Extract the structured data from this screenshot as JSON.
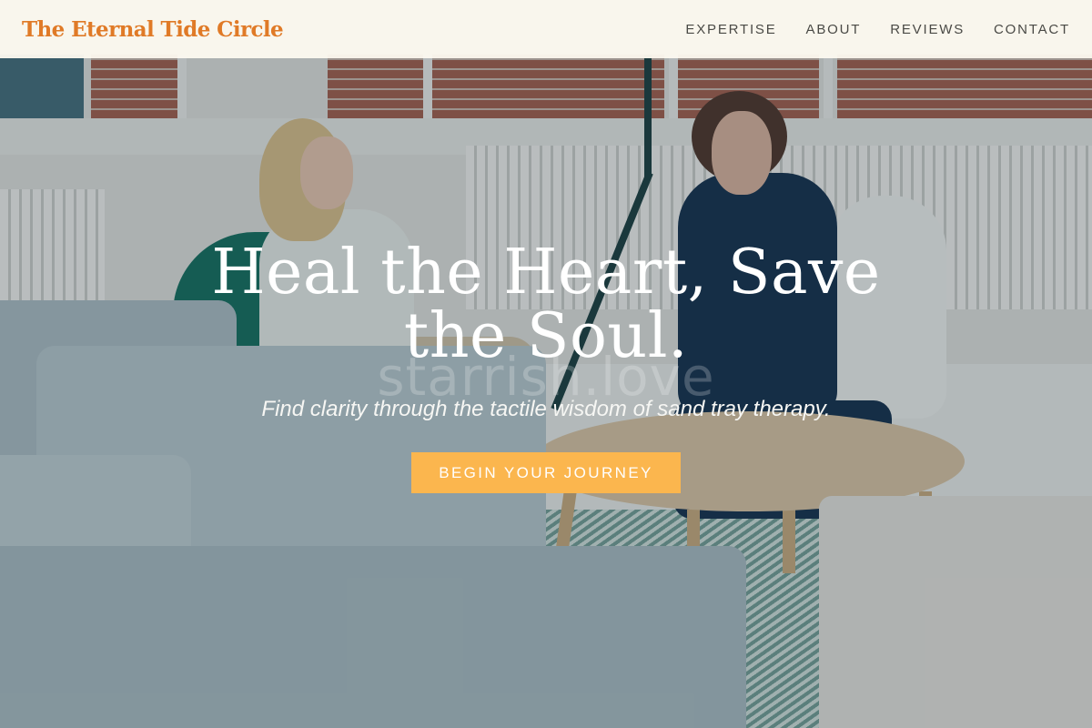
{
  "brand": {
    "name": "The Eternal Tide Circle"
  },
  "nav": {
    "items": [
      {
        "label": "EXPERTISE"
      },
      {
        "label": "ABOUT"
      },
      {
        "label": "REVIEWS"
      },
      {
        "label": "CONTACT"
      }
    ]
  },
  "hero": {
    "headline": "Heal the Heart, Save the Soul.",
    "watermark": "starrish.love",
    "subtitle": "Find clarity through the tactile wisdom of sand tray therapy.",
    "cta_label": "BEGIN YOUR JOURNEY"
  },
  "colors": {
    "brand_accent": "#e07a27",
    "cta_background": "#fbb64e",
    "header_background": "#fcf9ef"
  }
}
